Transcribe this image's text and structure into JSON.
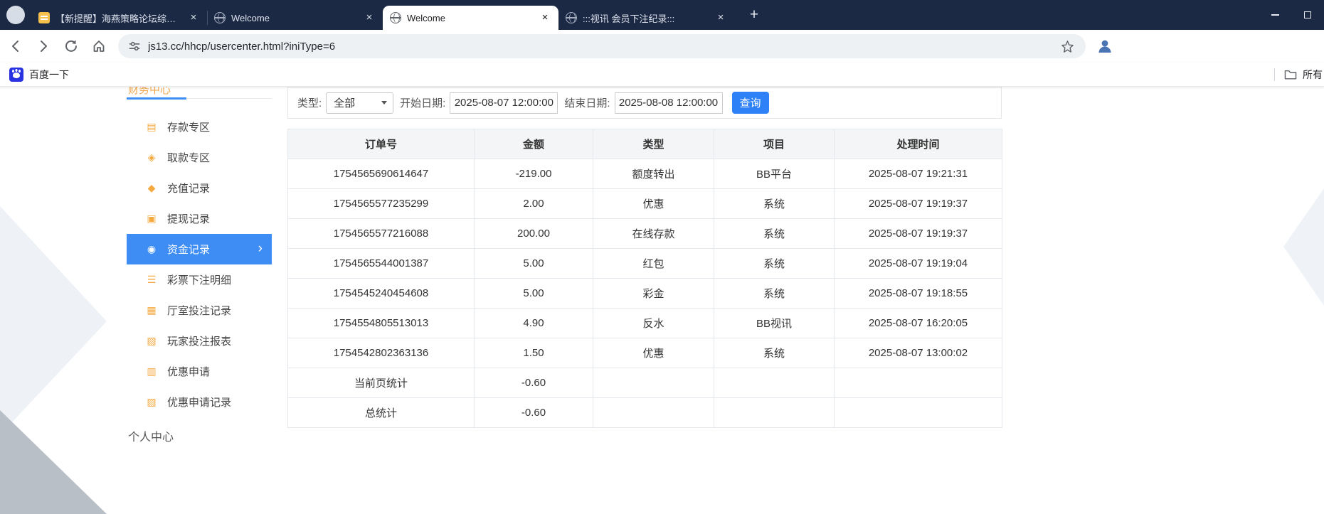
{
  "browser": {
    "tabs": [
      {
        "label": "【新提醒】海燕策略论坛综合交",
        "icon": "forum",
        "active": false
      },
      {
        "label": "Welcome",
        "icon": "globe",
        "active": false
      },
      {
        "label": "Welcome",
        "icon": "globe",
        "active": true
      },
      {
        "label": ":::视讯 会员下注纪录:::",
        "icon": "globe",
        "active": false
      }
    ],
    "tab_close_glyph": "×",
    "new_tab_label": "+",
    "url": "js13.cc/hhcp/usercenter.html?iniType=6",
    "bookmarks_bar": {
      "baidu_label": "百度一下",
      "all_bookmarks_label": "所有"
    }
  },
  "colors": {
    "titlebar": "#1c2945",
    "accent_blue": "#3d8df5",
    "button_blue": "#2e81f7",
    "icon_orange": "#f5a93f"
  },
  "sidebar": {
    "section_top": "财务中心",
    "section_bottom": "个人中心",
    "chevron_glyph": "›",
    "items": [
      {
        "label": "存款专区",
        "icon": "deposit-zone-icon",
        "glyph": "▤",
        "active": false
      },
      {
        "label": "取款专区",
        "icon": "withdraw-zone-icon",
        "glyph": "◈",
        "active": false
      },
      {
        "label": "充值记录",
        "icon": "recharge-record-icon",
        "glyph": "◆",
        "active": false
      },
      {
        "label": "提现记录",
        "icon": "withdrawal-record-icon",
        "glyph": "▣",
        "active": false
      },
      {
        "label": "资金记录",
        "icon": "funds-record-icon",
        "glyph": "◉",
        "active": true
      },
      {
        "label": "彩票下注明细",
        "icon": "lottery-bet-detail-icon",
        "glyph": "☰",
        "active": false
      },
      {
        "label": "厅室投注记录",
        "icon": "hall-bet-record-icon",
        "glyph": "▦",
        "active": false
      },
      {
        "label": "玩家投注报表",
        "icon": "player-bet-report-icon",
        "glyph": "▧",
        "active": false
      },
      {
        "label": "优惠申请",
        "icon": "promo-apply-icon",
        "glyph": "▥",
        "active": false
      },
      {
        "label": "优惠申请记录",
        "icon": "promo-apply-record-icon",
        "glyph": "▨",
        "active": false
      }
    ]
  },
  "filter": {
    "type_label": "类型:",
    "type_value": "全部",
    "start_label": "开始日期:",
    "start_value": "2025-08-07 12:00:00",
    "end_label": "结束日期:",
    "end_value": "2025-08-08 12:00:00",
    "search_button": "查询"
  },
  "table": {
    "headers": [
      "订单号",
      "金额",
      "类型",
      "项目",
      "处理时间"
    ],
    "rows": [
      [
        "1754565690614647",
        "-219.00",
        "额度转出",
        "BB平台",
        "2025-08-07 19:21:31"
      ],
      [
        "1754565577235299",
        "2.00",
        "优惠",
        "系统",
        "2025-08-07 19:19:37"
      ],
      [
        "1754565577216088",
        "200.00",
        "在线存款",
        "系统",
        "2025-08-07 19:19:37"
      ],
      [
        "1754565544001387",
        "5.00",
        "红包",
        "系统",
        "2025-08-07 19:19:04"
      ],
      [
        "1754545240454608",
        "5.00",
        "彩金",
        "系统",
        "2025-08-07 19:18:55"
      ],
      [
        "1754554805513013",
        "4.90",
        "反水",
        "BB视讯",
        "2025-08-07 16:20:05"
      ],
      [
        "1754542802363136",
        "1.50",
        "优惠",
        "系统",
        "2025-08-07 13:00:02"
      ],
      [
        "当前页统计",
        "-0.60",
        "",
        "",
        ""
      ],
      [
        "总统计",
        "-0.60",
        "",
        "",
        ""
      ]
    ]
  }
}
